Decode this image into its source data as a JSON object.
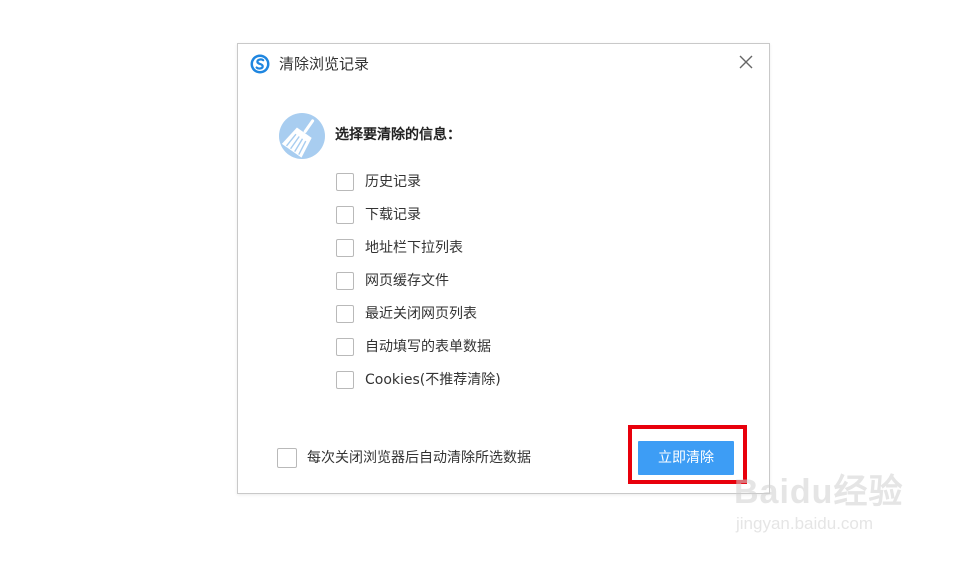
{
  "dialog": {
    "title": "清除浏览记录",
    "heading": "选择要清除的信息：",
    "options": [
      {
        "label": "历史记录",
        "checked": false
      },
      {
        "label": "下载记录",
        "checked": false
      },
      {
        "label": "地址栏下拉列表",
        "checked": false
      },
      {
        "label": "网页缓存文件",
        "checked": false
      },
      {
        "label": "最近关闭网页列表",
        "checked": false
      },
      {
        "label": "自动填写的表单数据",
        "checked": false
      },
      {
        "label": "Cookies(不推荐清除)",
        "checked": false
      }
    ],
    "auto_clear": {
      "label": "每次关闭浏览器后自动清除所选数据",
      "checked": false
    },
    "clear_button_label": "立即清除"
  },
  "icons": {
    "app_logo": "sogou-browser-logo-icon",
    "close": "close-icon",
    "broom": "broom-icon"
  },
  "colors": {
    "accent": "#3d9df5",
    "highlight": "#e8000c",
    "broom_circle": "#a8cdf0"
  },
  "watermark": {
    "brand": "Baidu经验",
    "url": "jingyan.baidu.com"
  }
}
